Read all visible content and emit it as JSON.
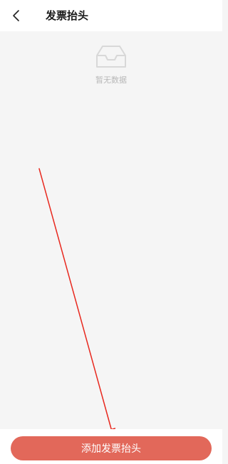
{
  "header": {
    "title": "发票抬头",
    "back_icon": "chevron-left-icon"
  },
  "empty_state": {
    "icon": "empty-inbox-icon",
    "message": "暂无数据"
  },
  "footer": {
    "add_button_label": "添加发票抬头"
  },
  "colors": {
    "primary": "#e2685a",
    "annotation_arrow": "#e8281e",
    "background": "#f5f5f5",
    "muted_text": "#b8b8b8"
  }
}
